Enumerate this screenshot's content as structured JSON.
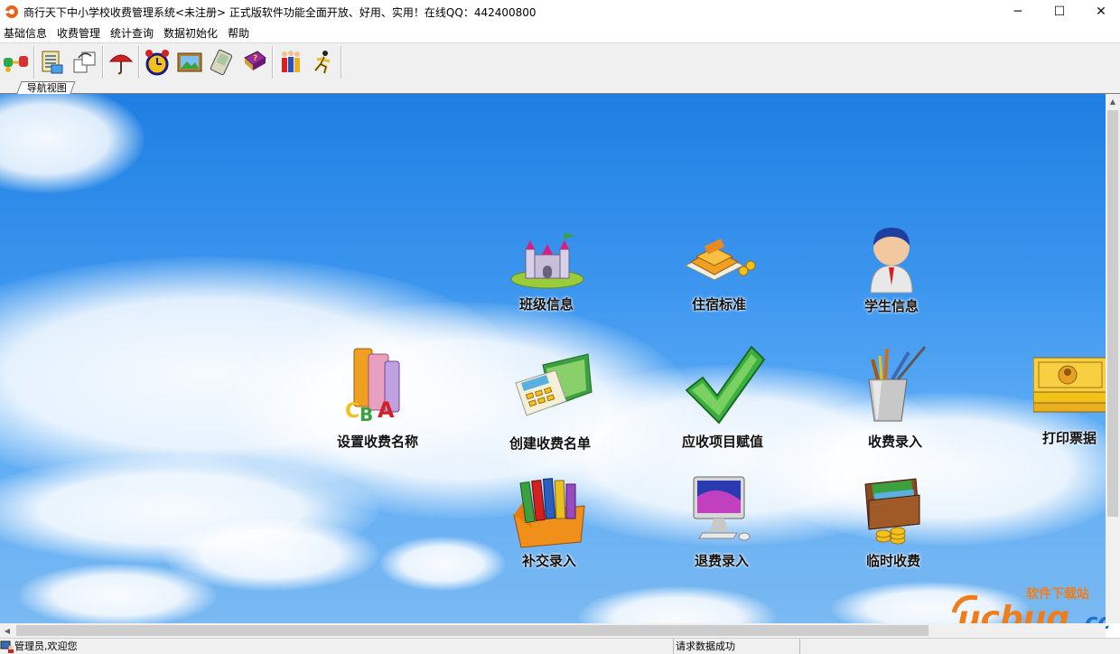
{
  "window": {
    "title": "商行天下中小学校收费管理系统<未注册> 正式版软件功能全面开放、好用、实用！在线QQ：442400800",
    "app_icon": "app-logo-icon",
    "controls": [
      "minimize-icon",
      "maximize-icon",
      "close-icon"
    ],
    "min_glyph": "─",
    "max_glyph": "☐",
    "close_glyph": "✕"
  },
  "menu": {
    "items": [
      "基础信息",
      "收费管理",
      "统计查询",
      "数据初始化",
      "帮助"
    ]
  },
  "toolbar": {
    "buttons": [
      "connect-icon",
      "document-list-icon",
      "transfer-icon",
      "umbrella-icon",
      "alarm-clock-icon",
      "picture-icon",
      "pda-icon",
      "help-book-icon",
      "family-icon",
      "exit-runner-icon"
    ]
  },
  "tabs": {
    "active": "导航视图"
  },
  "nav": {
    "class_info": "班级信息",
    "dorm_standard": "住宿标准",
    "student_info": "学生信息",
    "fee_name": "设置收费名称",
    "fee_list": "创建收费名单",
    "receivable": "应收项目赋值",
    "fee_entry": "收费录入",
    "print_receipt": "打印票据",
    "supplement": "补交录入",
    "refund": "退费录入",
    "temp_fee": "临时收费"
  },
  "status": {
    "user": "管理员,欢迎您",
    "message": "请求数据成功"
  },
  "watermark": {
    "brand": "ucbug",
    "suffix": ".cc",
    "caption": "软件下载站"
  },
  "colors": {
    "sky_top": "#1e7fe2",
    "accent_orange": "#e8621a",
    "watermark_orange": "#f07d1a",
    "watermark_blue": "#1f6fd1"
  }
}
